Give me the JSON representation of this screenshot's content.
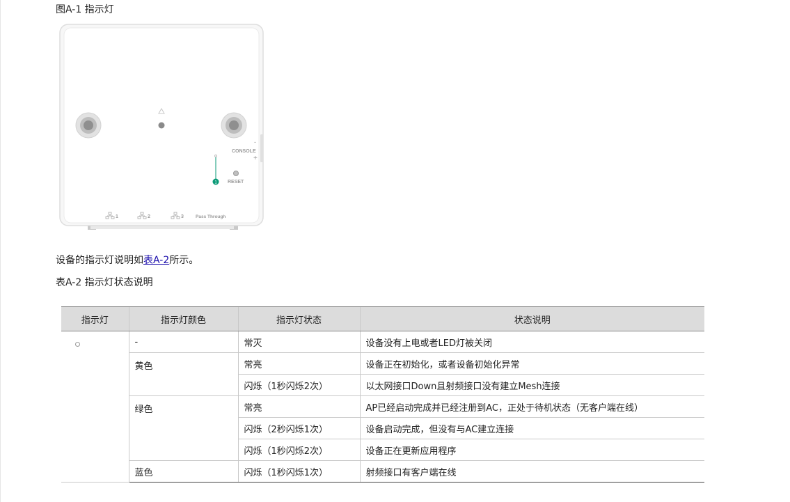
{
  "figure": {
    "caption": "图A-1 指示灯",
    "device_labels": {
      "console": "CONSOLE",
      "console_minus": "-",
      "console_plus": "+",
      "reset": "RESET",
      "led_number": "1",
      "port1": "1",
      "port2": "2",
      "port3": "3",
      "pass_through": "Pass Through"
    }
  },
  "paragraph": {
    "prefix": "设备的指示灯说明如",
    "link": "表A-2",
    "suffix": "所示。"
  },
  "table": {
    "caption": "表A-2 指示灯状态说明",
    "headers": [
      "指示灯",
      "指示灯颜色",
      "指示灯状态",
      "状态说明"
    ],
    "rows": [
      {
        "color": "-",
        "state": "常灭",
        "desc": "设备没有上电或者LED灯被关闭"
      },
      {
        "color": "黄色",
        "state": "常亮",
        "desc": "设备正在初始化，或者设备初始化异常"
      },
      {
        "color": "",
        "state": "闪烁（1秒闪烁2次）",
        "desc": "以太网接口Down且射频接口没有建立Mesh连接"
      },
      {
        "color": "绿色",
        "state": "常亮",
        "desc": "AP已经启动完成并已经注册到AC，正处于待机状态（无客户端在线）"
      },
      {
        "color": "",
        "state": "闪烁（2秒闪烁1次）",
        "desc": "设备启动完成，但没有与AC建立连接"
      },
      {
        "color": "",
        "state": "闪烁（1秒闪烁2次）",
        "desc": "设备正在更新应用程序"
      },
      {
        "color": "蓝色",
        "state": "闪烁（1秒闪烁1次）",
        "desc": "射频接口有客户端在线"
      }
    ],
    "indicator_icon": "led-ring-icon"
  }
}
